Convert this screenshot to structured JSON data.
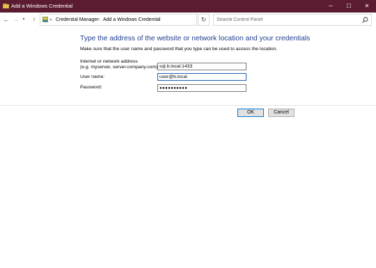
{
  "window": {
    "title": "Add a Windows Credential",
    "min_glyph": "─",
    "max_glyph": "☐",
    "close_glyph": "✕",
    "accent_color": "#5b1c31"
  },
  "navigation": {
    "back_glyph": "←",
    "forward_glyph": "→",
    "recent_glyph": "▾",
    "up_glyph": "↑",
    "breadcrumb_sep": "»",
    "crumb_sep": "›",
    "breadcrumbs": [
      "Credential Manager",
      "Add a Windows Credential"
    ],
    "dropdown_glyph": "⌄",
    "refresh_glyph": "↻",
    "search_placeholder": "Search Control Panel"
  },
  "form": {
    "heading": "Type the address of the website or network location and your credentials",
    "subtext": "Make sure that the user name and password that you type can be used to access the location.",
    "address_label_line1": "Internet or network address",
    "address_label_line2": "(e.g. myserver, server.company.com):",
    "address_value": "sql.b.local:1433",
    "username_label": "User name:",
    "username_value": "user@b.local",
    "password_label": "Password:",
    "password_mask": "●●●●●●●●●●"
  },
  "buttons": {
    "ok": "OK",
    "cancel": "Cancel"
  }
}
